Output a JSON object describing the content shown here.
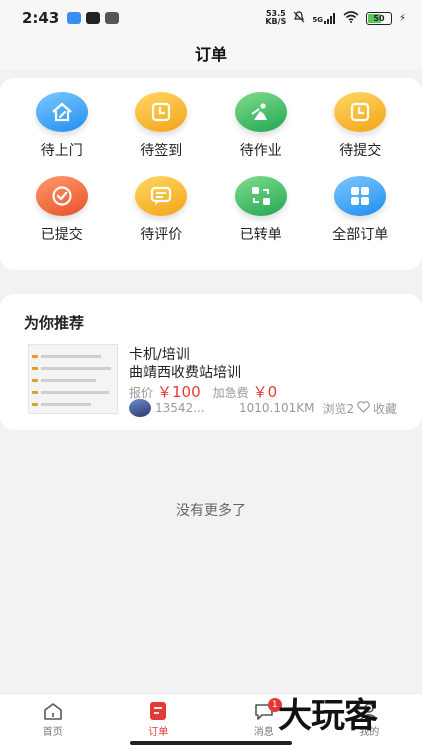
{
  "status_bar": {
    "time": "2:43",
    "net_speed_top": "53.5",
    "net_speed_bottom": "KB/S",
    "signal": "5G",
    "battery": "50"
  },
  "header": {
    "title": "订单"
  },
  "order_status": {
    "items": [
      {
        "label": "待上门",
        "icon": "house-wrench-icon",
        "color": "#36a6f5"
      },
      {
        "label": "待签到",
        "icon": "clock-icon",
        "color": "#f6b92c"
      },
      {
        "label": "待作业",
        "icon": "worker-icon",
        "color": "#3dbb6a"
      },
      {
        "label": "待提交",
        "icon": "clock-icon",
        "color": "#f6b92c"
      },
      {
        "label": "已提交",
        "icon": "check-icon",
        "color": "#f06a3a"
      },
      {
        "label": "待评价",
        "icon": "comment-icon",
        "color": "#f6b92c"
      },
      {
        "label": "已转单",
        "icon": "transfer-icon",
        "color": "#3dbb6a"
      },
      {
        "label": "全部订单",
        "icon": "grid-icon",
        "color": "#36a6f5"
      }
    ]
  },
  "recommend": {
    "title": "为你推荐",
    "item": {
      "category": "卡机/培训",
      "name": "曲靖西收费站培训",
      "price_label": "报价",
      "price": "￥100",
      "urgent_label": "加急费",
      "urgent_fee": "￥0",
      "phone": "13542...",
      "distance": "1010.101KM",
      "views": "浏览2",
      "favorite": "收藏"
    }
  },
  "footer_text": "没有更多了",
  "tabbar": {
    "tabs": [
      {
        "label": "首页",
        "icon": "home-icon"
      },
      {
        "label": "订单",
        "icon": "order-icon"
      },
      {
        "label": "消息",
        "icon": "message-icon",
        "badge": "1"
      },
      {
        "label": "我的",
        "icon": "user-icon"
      }
    ]
  },
  "watermark": "大玩客"
}
